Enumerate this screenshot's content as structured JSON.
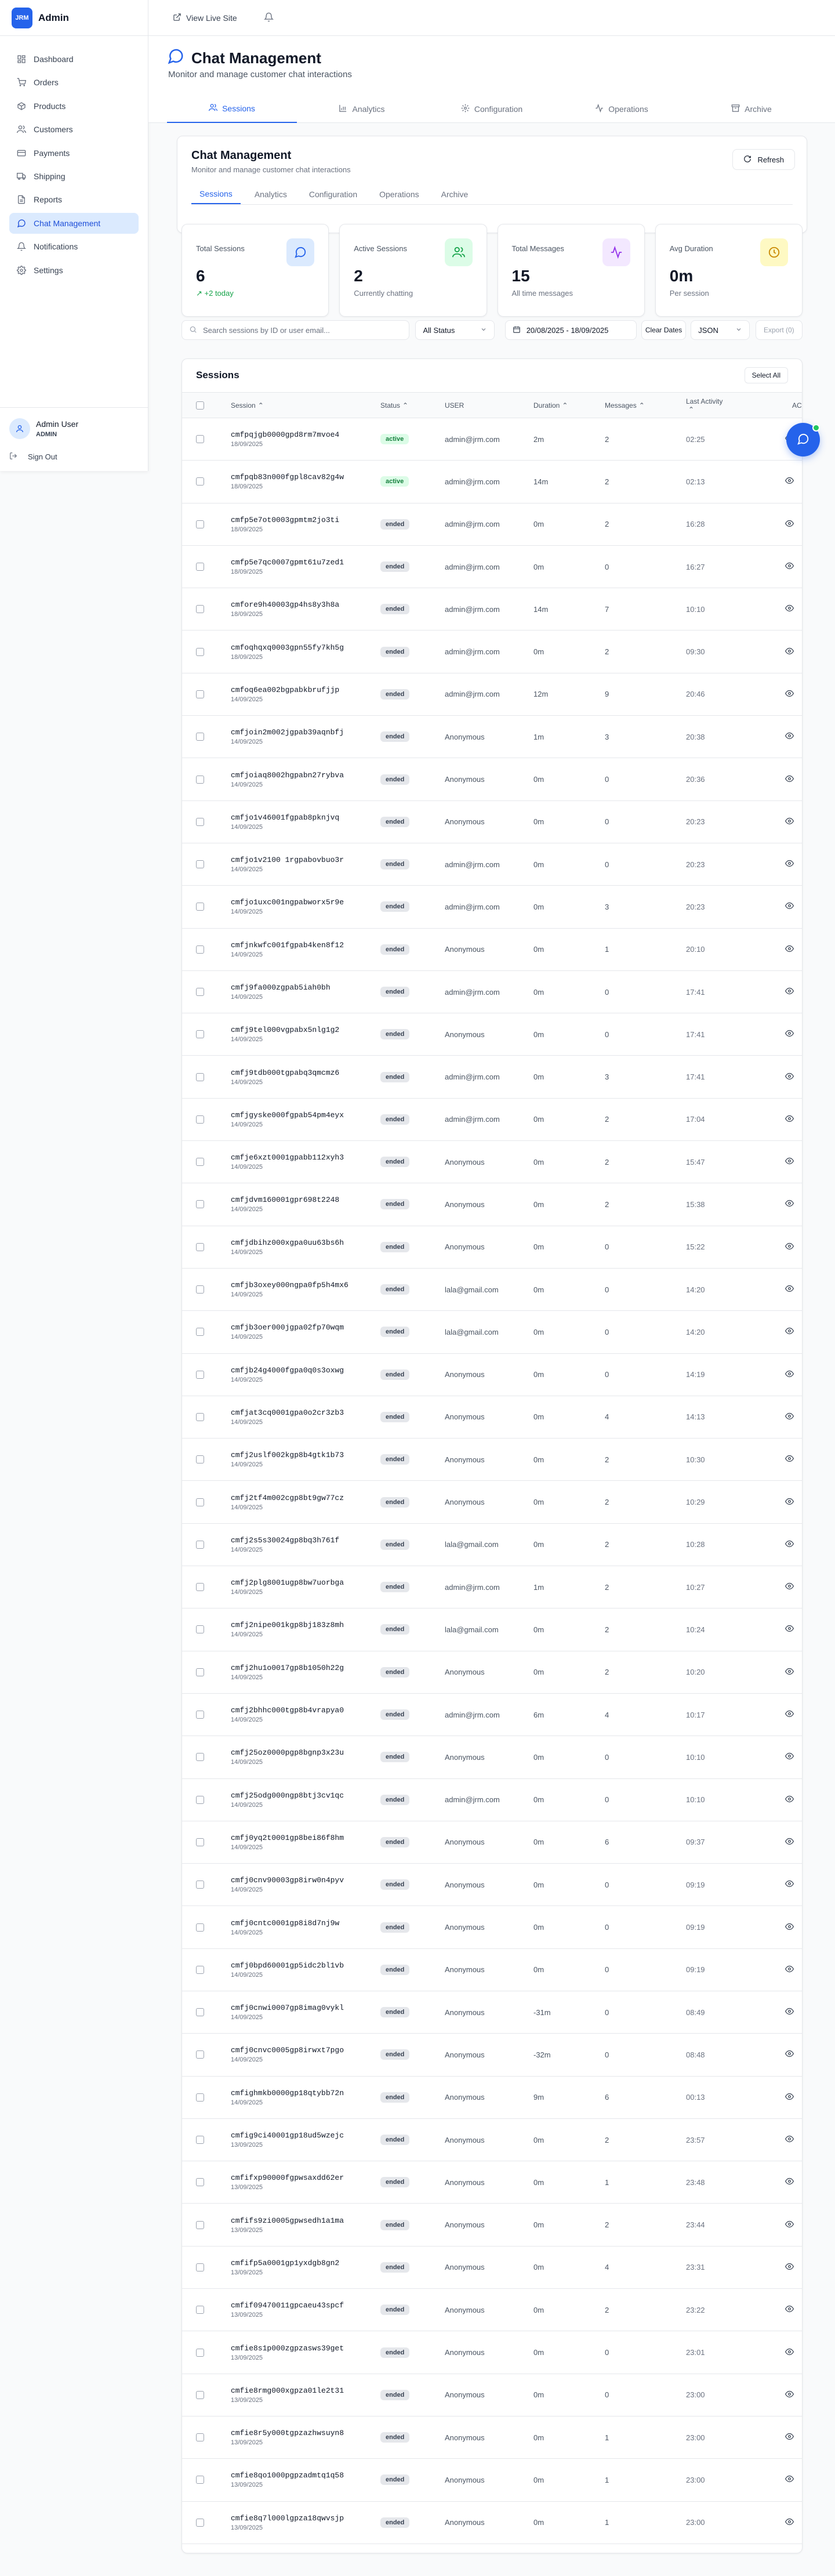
{
  "brand": {
    "logo": "JRM",
    "name": "Admin"
  },
  "sidebar": {
    "items": [
      {
        "label": "Dashboard"
      },
      {
        "label": "Orders"
      },
      {
        "label": "Products"
      },
      {
        "label": "Customers"
      },
      {
        "label": "Payments"
      },
      {
        "label": "Shipping"
      },
      {
        "label": "Reports"
      },
      {
        "label": "Chat Management"
      },
      {
        "label": "Notifications"
      },
      {
        "label": "Settings"
      }
    ],
    "active_index": 7,
    "user": {
      "name": "Admin User",
      "role": "ADMIN",
      "signout": "Sign Out"
    }
  },
  "topbar": {
    "live_site": "View Live Site"
  },
  "header": {
    "title": "Chat Management",
    "subtitle": "Monitor and manage customer chat interactions",
    "tabs": [
      "Sessions",
      "Analytics",
      "Configuration",
      "Operations",
      "Archive"
    ]
  },
  "content": {
    "title": "Chat Management",
    "subtitle": "Monitor and manage customer chat interactions",
    "refresh": "Refresh",
    "tabs": [
      "Sessions",
      "Analytics",
      "Configuration",
      "Operations",
      "Archive"
    ]
  },
  "stats": [
    {
      "label": "Total Sessions",
      "value": "6",
      "note": "↗ +2 today"
    },
    {
      "label": "Active Sessions",
      "value": "2",
      "note": "Currently chatting"
    },
    {
      "label": "Total Messages",
      "value": "15",
      "note": "All time messages"
    },
    {
      "label": "Avg Duration",
      "value": "0m",
      "note": "Per session"
    }
  ],
  "filters": {
    "search_placeholder": "Search sessions by ID or user email...",
    "status": "All Status",
    "date_range": "20/08/2025 - 18/09/2025",
    "clear_dates": "Clear Dates",
    "format": "JSON",
    "export": "Export (0)"
  },
  "table": {
    "title": "Sessions",
    "select_all": "Select All",
    "columns": {
      "session": "Session",
      "status": "Status",
      "user": "USER",
      "duration": "Duration",
      "messages": "Messages",
      "last_activity": "Last Activity",
      "actions": "AC"
    },
    "rows": [
      [
        "cmfpqjgb0000gpd8rm7mvoe4",
        "18/09/2025",
        "active",
        "admin@jrm.com",
        "2m",
        "2",
        "02:25"
      ],
      [
        "cmfpqb83n000fgpl8cav82g4w",
        "18/09/2025",
        "active",
        "admin@jrm.com",
        "14m",
        "2",
        "02:13"
      ],
      [
        "cmfp5e7ot0003gpmtm2jo3ti",
        "18/09/2025",
        "ended",
        "admin@jrm.com",
        "0m",
        "2",
        "16:28"
      ],
      [
        "cmfp5e7qc0007gpmt61u7zed1",
        "18/09/2025",
        "ended",
        "admin@jrm.com",
        "0m",
        "0",
        "16:27"
      ],
      [
        "cmfore9h40003gp4hs8y3h8a",
        "18/09/2025",
        "ended",
        "admin@jrm.com",
        "14m",
        "7",
        "10:10"
      ],
      [
        "cmfoqhqxq0003gpn55fy7kh5g",
        "18/09/2025",
        "ended",
        "admin@jrm.com",
        "0m",
        "2",
        "09:30"
      ],
      [
        "cmfoq6ea002bgpabkbrufjjp",
        "14/09/2025",
        "ended",
        "admin@jrm.com",
        "12m",
        "9",
        "20:46"
      ],
      [
        "cmfjoin2m002jgpab39aqnbfj",
        "14/09/2025",
        "ended",
        "Anonymous",
        "1m",
        "3",
        "20:38"
      ],
      [
        "cmfjoiaq8002hgpabn27rybva",
        "14/09/2025",
        "ended",
        "Anonymous",
        "0m",
        "0",
        "20:36"
      ],
      [
        "cmfjo1v46001fgpab8pknjvq",
        "14/09/2025",
        "ended",
        "Anonymous",
        "0m",
        "0",
        "20:23"
      ],
      [
        "cmfjo1v2100 1rgpabovbuo3r",
        "14/09/2025",
        "ended",
        "admin@jrm.com",
        "0m",
        "0",
        "20:23"
      ],
      [
        "cmfjo1uxc001ngpabworx5r9e",
        "14/09/2025",
        "ended",
        "admin@jrm.com",
        "0m",
        "3",
        "20:23"
      ],
      [
        "cmfjnkwfc001fgpab4ken8f12",
        "14/09/2025",
        "ended",
        "Anonymous",
        "0m",
        "1",
        "20:10"
      ],
      [
        "cmfj9fa000zgpab5iah0bh",
        "14/09/2025",
        "ended",
        "admin@jrm.com",
        "0m",
        "0",
        "17:41"
      ],
      [
        "cmfj9tel000vgpabx5nlg1g2",
        "14/09/2025",
        "ended",
        "Anonymous",
        "0m",
        "0",
        "17:41"
      ],
      [
        "cmfj9tdb000tgpabq3qmcmz6",
        "14/09/2025",
        "ended",
        "admin@jrm.com",
        "0m",
        "3",
        "17:41"
      ],
      [
        "cmfjgyske000fgpab54pm4eyx",
        "14/09/2025",
        "ended",
        "admin@jrm.com",
        "0m",
        "2",
        "17:04"
      ],
      [
        "cmfje6xzt0001gpabb112xyh3",
        "14/09/2025",
        "ended",
        "Anonymous",
        "0m",
        "2",
        "15:47"
      ],
      [
        "cmfjdvm160001gpr698t2248",
        "14/09/2025",
        "ended",
        "Anonymous",
        "0m",
        "2",
        "15:38"
      ],
      [
        "cmfjdbihz000xgpa0uu63bs6h",
        "14/09/2025",
        "ended",
        "Anonymous",
        "0m",
        "0",
        "15:22"
      ],
      [
        "cmfjb3oxey000ngpa0fp5h4mx6",
        "14/09/2025",
        "ended",
        "lala@gmail.com",
        "0m",
        "0",
        "14:20"
      ],
      [
        "cmfjb3oer000jgpa02fp70wqm",
        "14/09/2025",
        "ended",
        "lala@gmail.com",
        "0m",
        "0",
        "14:20"
      ],
      [
        "cmfjb24g4000fgpa0q0s3oxwg",
        "14/09/2025",
        "ended",
        "Anonymous",
        "0m",
        "0",
        "14:19"
      ],
      [
        "cmfjat3cq0001gpa0o2cr3zb3",
        "14/09/2025",
        "ended",
        "Anonymous",
        "0m",
        "4",
        "14:13"
      ],
      [
        "cmfj2uslf002kgp8b4gtk1b73",
        "14/09/2025",
        "ended",
        "Anonymous",
        "0m",
        "2",
        "10:30"
      ],
      [
        "cmfj2tf4m002cgp8bt9gw77cz",
        "14/09/2025",
        "ended",
        "Anonymous",
        "0m",
        "2",
        "10:29"
      ],
      [
        "cmfj2s5s30024gp8bq3h761f",
        "14/09/2025",
        "ended",
        "lala@gmail.com",
        "0m",
        "2",
        "10:28"
      ],
      [
        "cmfj2plg8001ugp8bw7uorbga",
        "14/09/2025",
        "ended",
        "admin@jrm.com",
        "1m",
        "2",
        "10:27"
      ],
      [
        "cmfj2nipe001kgp8bj183z8mh",
        "14/09/2025",
        "ended",
        "lala@gmail.com",
        "0m",
        "2",
        "10:24"
      ],
      [
        "cmfj2hu1o0017gp8b1050h22g",
        "14/09/2025",
        "ended",
        "Anonymous",
        "0m",
        "2",
        "10:20"
      ],
      [
        "cmfj2bhhc000tgp8b4vrapya0",
        "14/09/2025",
        "ended",
        "admin@jrm.com",
        "6m",
        "4",
        "10:17"
      ],
      [
        "cmfj25oz0000pgp8bgnp3x23u",
        "14/09/2025",
        "ended",
        "Anonymous",
        "0m",
        "0",
        "10:10"
      ],
      [
        "cmfj25odg000ngp8btj3cv1qc",
        "14/09/2025",
        "ended",
        "admin@jrm.com",
        "0m",
        "0",
        "10:10"
      ],
      [
        "cmfj0yq2t0001gp8bei86f8hm",
        "14/09/2025",
        "ended",
        "Anonymous",
        "0m",
        "6",
        "09:37"
      ],
      [
        "cmfj0cnv90003gp8irw0n4pyv",
        "14/09/2025",
        "ended",
        "Anonymous",
        "0m",
        "0",
        "09:19"
      ],
      [
        "cmfj0cntc0001gp8i8d7nj9w",
        "14/09/2025",
        "ended",
        "Anonymous",
        "0m",
        "0",
        "09:19"
      ],
      [
        "cmfj0bpd60001gp5idc2bl1vb",
        "14/09/2025",
        "ended",
        "Anonymous",
        "0m",
        "0",
        "09:19"
      ],
      [
        "cmfj0cnwi0007gp8imag0vykl",
        "14/09/2025",
        "ended",
        "Anonymous",
        "-31m",
        "0",
        "08:49"
      ],
      [
        "cmfj0cnvc0005gp8irwxt7pgo",
        "14/09/2025",
        "ended",
        "Anonymous",
        "-32m",
        "0",
        "08:48"
      ],
      [
        "cmfighmkb0000gp18qtybb72n",
        "14/09/2025",
        "ended",
        "Anonymous",
        "9m",
        "6",
        "00:13"
      ],
      [
        "cmfig9ci40001gp18ud5wzejc",
        "13/09/2025",
        "ended",
        "Anonymous",
        "0m",
        "2",
        "23:57"
      ],
      [
        "cmfifxp90000fgpwsaxdd62er",
        "13/09/2025",
        "ended",
        "Anonymous",
        "0m",
        "1",
        "23:48"
      ],
      [
        "cmfifs9zi0005gpwsedh1a1ma",
        "13/09/2025",
        "ended",
        "Anonymous",
        "0m",
        "2",
        "23:44"
      ],
      [
        "cmfifp5a0001gp1yxdgb8gn2",
        "13/09/2025",
        "ended",
        "Anonymous",
        "0m",
        "4",
        "23:31"
      ],
      [
        "cmfif09470011gpcaeu43spcf",
        "13/09/2025",
        "ended",
        "Anonymous",
        "0m",
        "2",
        "23:22"
      ],
      [
        "cmfie8s1p000zgpzasws39get",
        "13/09/2025",
        "ended",
        "Anonymous",
        "0m",
        "0",
        "23:01"
      ],
      [
        "cmfie8rmg000xgpza01le2t31",
        "13/09/2025",
        "ended",
        "Anonymous",
        "0m",
        "0",
        "23:00"
      ],
      [
        "cmfie8r5y000tgpzazhwsuyn8",
        "13/09/2025",
        "ended",
        "Anonymous",
        "0m",
        "1",
        "23:00"
      ],
      [
        "cmfie8qo1000pgpzadmtq1q58",
        "13/09/2025",
        "ended",
        "Anonymous",
        "0m",
        "1",
        "23:00"
      ],
      [
        "cmfie8q7l000lgpza18qwvsjp",
        "13/09/2025",
        "ended",
        "Anonymous",
        "0m",
        "1",
        "23:00"
      ]
    ]
  },
  "colors": {
    "accent": "#2563eb",
    "active_bg": "#dcfce7",
    "active_fg": "#15803d",
    "ended_bg": "#e5e7eb"
  }
}
